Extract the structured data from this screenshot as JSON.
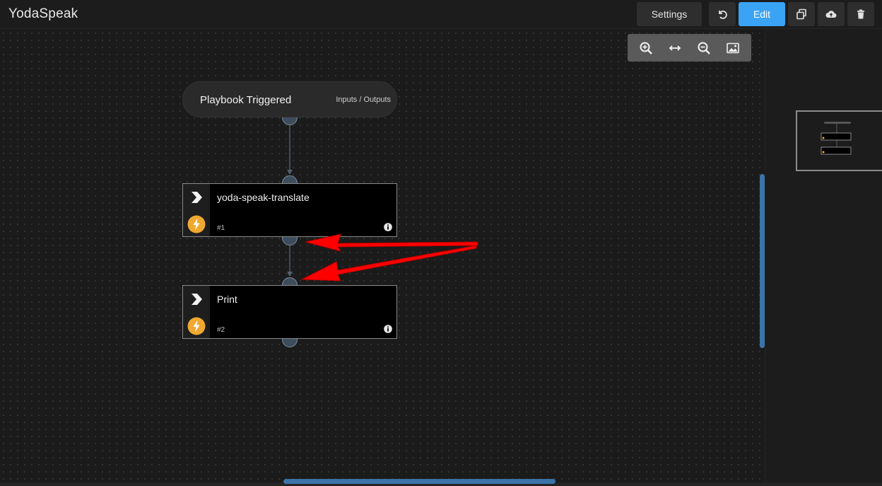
{
  "header": {
    "title": "YodaSpeak",
    "settings_label": "Settings",
    "edit_label": "Edit",
    "icons": [
      "undo-icon",
      "copy-icon",
      "cloud-upload-icon",
      "trash-icon"
    ]
  },
  "zoom_toolbar": {
    "icons": [
      "zoom-in-icon",
      "fit-width-icon",
      "zoom-out-icon",
      "image-export-icon"
    ]
  },
  "flow": {
    "trigger": {
      "label": "Playbook Triggered",
      "link": "Inputs / Outputs"
    },
    "tasks": [
      {
        "name": "yoda-speak-translate",
        "number": "#1"
      },
      {
        "name": "Print",
        "number": "#2"
      }
    ]
  },
  "annotation": {
    "arrows_color": "#ff0000"
  },
  "colors": {
    "accent": "#3aa3f4",
    "bolt": "#f0a830",
    "scroll": "#3a74a9"
  }
}
